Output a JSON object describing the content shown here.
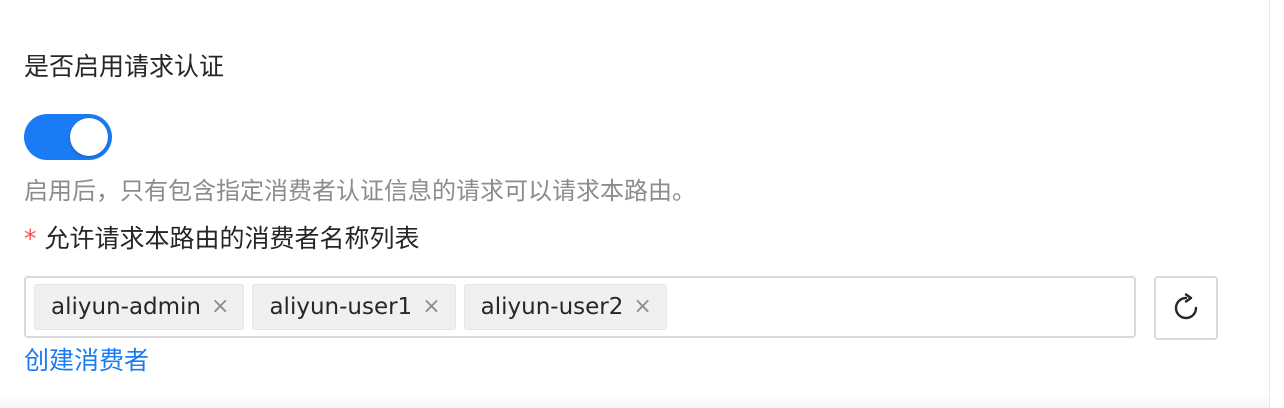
{
  "form": {
    "auth_label": "是否启用请求认证",
    "auth_enabled": true,
    "auth_help": "启用后，只有包含指定消费者认证信息的请求可以请求本路由。",
    "consumers_required_mark": "*",
    "consumers_label": "允许请求本路由的消费者名称列表",
    "consumers": [
      {
        "label": "aliyun-admin",
        "remove_glyph": "×"
      },
      {
        "label": "aliyun-user1",
        "remove_glyph": "×"
      },
      {
        "label": "aliyun-user2",
        "remove_glyph": "×"
      }
    ],
    "refresh_icon": "refresh-icon",
    "create_link": "创建消费者"
  },
  "colors": {
    "accent": "#1a7cf4",
    "required": "#ff4d4f",
    "help_text": "#8c8c8c",
    "tag_bg": "#f0f0f0",
    "border": "#d9d9d9"
  }
}
